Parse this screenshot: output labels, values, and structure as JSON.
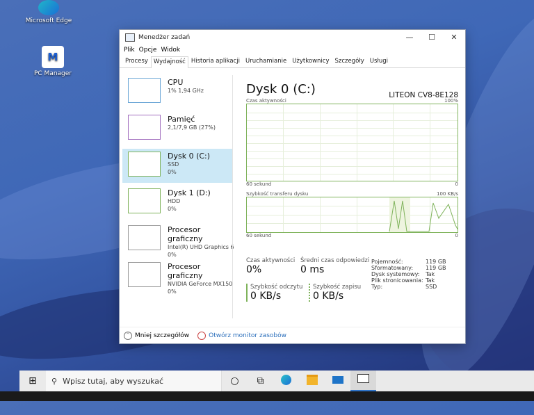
{
  "desktop": {
    "icons": [
      {
        "label": "Microsoft Edge"
      },
      {
        "label": "PC Manager",
        "glyph": "M"
      }
    ]
  },
  "window": {
    "title": "Menedżer zadań",
    "menu": [
      "Plik",
      "Opcje",
      "Widok"
    ],
    "tabs": [
      "Procesy",
      "Wydajność",
      "Historia aplikacji",
      "Uruchamianie",
      "Użytkownicy",
      "Szczegóły",
      "Usługi"
    ],
    "active_tab": "Wydajność",
    "controls": {
      "minimize": "—",
      "maximize": "☐",
      "close": "✕"
    }
  },
  "left_panel": {
    "items": [
      {
        "name": "CPU",
        "line1": "1% 1,94 GHz",
        "line2": ""
      },
      {
        "name": "Pamięć",
        "line1": "2,1/7,9 GB (27%)",
        "line2": ""
      },
      {
        "name": "Dysk 0 (C:)",
        "line1": "SSD",
        "line2": "0%"
      },
      {
        "name": "Dysk 1 (D:)",
        "line1": "HDD",
        "line2": "0%"
      },
      {
        "name": "Procesor graficzny",
        "line1": "Intel(R) UHD Graphics 6",
        "line2": "0%"
      },
      {
        "name": "Procesor graficzny",
        "line1": "NVIDIA GeForce MX150",
        "line2": "0%"
      }
    ]
  },
  "detail": {
    "title": "Dysk 0 (C:)",
    "model": "LITEON CV8-8E128",
    "graph1": {
      "label": "Czas aktywności",
      "max": "100%",
      "time": "60 sekund",
      "min": "0"
    },
    "graph2": {
      "label": "Szybkość transferu dysku",
      "max": "100 KB/s",
      "time": "60 sekund",
      "min": "0"
    },
    "stats": {
      "active_label": "Czas aktywności",
      "active_value": "0%",
      "response_label": "Średni czas odpowiedzi",
      "response_value": "0 ms",
      "read_label": "Szybkość odczytu",
      "read_value": "0 KB/s",
      "write_label": "Szybkość zapisu",
      "write_value": "0 KB/s"
    },
    "properties": [
      {
        "k": "Pojemność:",
        "v": "119 GB"
      },
      {
        "k": "Sformatowany:",
        "v": "119 GB"
      },
      {
        "k": "Dysk systemowy:",
        "v": "Tak"
      },
      {
        "k": "Plik stronicowania:",
        "v": "Tak"
      },
      {
        "k": "Typ:",
        "v": "SSD"
      }
    ]
  },
  "footer": {
    "less_details": "Mniej szczegółów",
    "resource_monitor": "Otwórz monitor zasobów"
  },
  "taskbar": {
    "search_placeholder": "Wpisz tutaj, aby wyszukać"
  }
}
